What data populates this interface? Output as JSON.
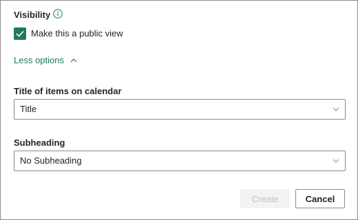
{
  "visibility": {
    "label": "Visibility",
    "info_icon": "info-icon",
    "public_view": {
      "checked": true,
      "label": "Make this a public view"
    }
  },
  "less_options": {
    "label": "Less options",
    "icon": "chevron-up-icon"
  },
  "title_field": {
    "label": "Title of items on calendar",
    "value": "Title",
    "icon": "chevron-down-icon"
  },
  "subheading_field": {
    "label": "Subheading",
    "value": "No Subheading",
    "icon": "chevron-down-icon"
  },
  "buttons": {
    "create": "Create",
    "cancel": "Cancel"
  },
  "colors": {
    "accent": "#217a5b",
    "link": "#1b7a5a",
    "border": "#8a8a8a",
    "disabled_bg": "#f3f3f3",
    "disabled_text": "#c2c2c2"
  }
}
